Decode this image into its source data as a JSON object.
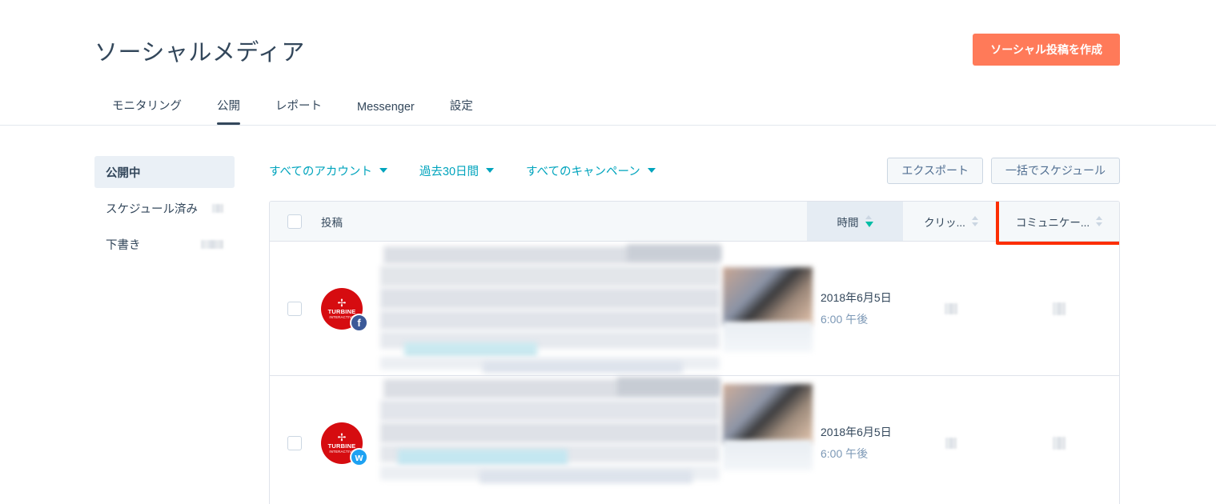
{
  "header": {
    "title": "ソーシャルメディア",
    "create_button": "ソーシャル投稿を作成",
    "accent_orange": "#ff7a59",
    "tabs": [
      {
        "label": "モニタリング",
        "active": false
      },
      {
        "label": "公開",
        "active": true
      },
      {
        "label": "レポート",
        "active": false
      },
      {
        "label": "Messenger",
        "active": false
      },
      {
        "label": "設定",
        "active": false
      }
    ]
  },
  "sidebar": {
    "items": [
      {
        "label": "公開中",
        "active": true,
        "badge_redacted": false,
        "badge_width": 0
      },
      {
        "label": "スケジュール済み",
        "active": false,
        "badge_redacted": true,
        "badge_width": 14
      },
      {
        "label": "下書き",
        "active": false,
        "badge_redacted": true,
        "badge_width": 28
      }
    ]
  },
  "filters": [
    {
      "label": "すべてのアカウント"
    },
    {
      "label": "過去30日間"
    },
    {
      "label": "すべてのキャンペーン"
    }
  ],
  "toolbar": {
    "export_label": "エクスポート",
    "bulk_schedule_label": "一括でスケジュール"
  },
  "table": {
    "columns": {
      "post": "投稿",
      "time": "時間",
      "clicks": "クリッ...",
      "communication": "コミュニケー..."
    },
    "sort": {
      "active_column": "time",
      "direction": "desc",
      "active_arrow_color": "#00bda5"
    },
    "highlight": {
      "column": "communication",
      "border_color": "#fc2e02",
      "border_width_px": 4
    },
    "rows": [
      {
        "selected": false,
        "account_name": "TURBINE",
        "account_sub": "INTERACTIVE",
        "network": "facebook",
        "network_badge_color": "#3b5998",
        "date": "2018年6月5日",
        "time": "6:00 午後",
        "content_redacted": true,
        "clicks_redacted": true,
        "communication_redacted": true
      },
      {
        "selected": false,
        "account_name": "TURBINE",
        "account_sub": "INTERACTIVE",
        "network": "twitter",
        "network_badge_color": "#1da1f2",
        "date": "2018年6月5日",
        "time": "6:00 午後",
        "content_redacted": true,
        "clicks_redacted": true,
        "communication_redacted": true
      }
    ]
  }
}
